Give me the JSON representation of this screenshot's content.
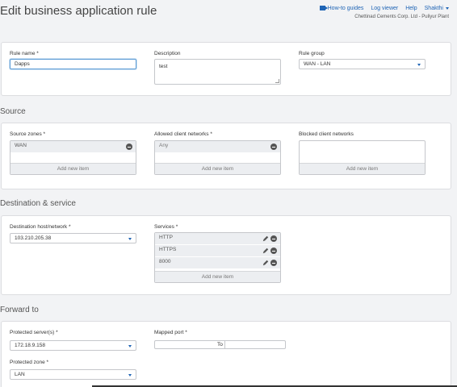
{
  "header": {
    "title": "Edit business application rule",
    "nav": {
      "howto": "How-to guides",
      "log": "Log viewer",
      "help": "Help",
      "user": "Shakthi"
    },
    "org": "Chettinad Cements Corp. Ltd - Puliyur Plant"
  },
  "rule": {
    "name_label": "Rule name *",
    "name_value": "Dapps",
    "desc_label": "Description",
    "desc_value": "test",
    "group_label": "Rule group",
    "group_value": "WAN - LAN"
  },
  "source": {
    "title": "Source",
    "zones_label": "Source zones *",
    "zones": [
      "WAN"
    ],
    "allowed_label": "Allowed client networks *",
    "allowed": [
      "Any"
    ],
    "blocked_label": "Blocked client networks",
    "add_new": "Add new item"
  },
  "destination": {
    "title": "Destination & service",
    "host_label": "Destination host/network *",
    "host_value": "103.210.205.38",
    "services_label": "Services *",
    "services": [
      "HTTP",
      "HTTPS",
      "8000"
    ],
    "add_new": "Add new item"
  },
  "forward": {
    "title": "Forward to",
    "server_label": "Protected server(s) *",
    "server_value": "172.18.9.158",
    "port_label": "Mapped port *",
    "port_to": "To",
    "zone_label": "Protected zone *",
    "zone_value": "LAN"
  }
}
